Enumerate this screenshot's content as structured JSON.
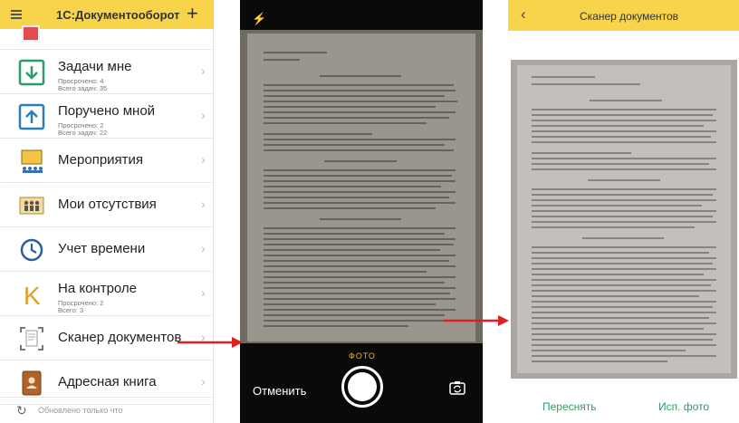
{
  "app": {
    "title": "1С:Документооборот",
    "footer_text": "Обновлено только что",
    "items": [
      {
        "label": "Задачи мне",
        "sub1": "Просрочено: 4",
        "sub2": "Всего задач: 35",
        "icon": "download-task-icon"
      },
      {
        "label": "Поручено мной",
        "sub1": "Просрочено: 2",
        "sub2": "Всего задач: 22",
        "icon": "upload-task-icon"
      },
      {
        "label": "Мероприятия",
        "icon": "presentation-icon"
      },
      {
        "label": "Мои отсутствия",
        "icon": "absence-people-icon"
      },
      {
        "label": "Учет времени",
        "icon": "clock-icon"
      },
      {
        "label": "На контроле",
        "sub1": "Просрочено: 2",
        "sub2": "Всего: 3",
        "icon": "control-k-icon"
      },
      {
        "label": "Сканер документов",
        "icon": "scanner-icon"
      },
      {
        "label": "Адресная книга",
        "icon": "address-book-icon"
      }
    ]
  },
  "camera": {
    "mode_label": "ФОТО",
    "cancel_label": "Отменить"
  },
  "scanner": {
    "title": "Сканер документов",
    "retake_label": "Переснять",
    "use_photo_label": "Исп. фото"
  },
  "colors": {
    "header_yellow": "#f7d44a",
    "accent_green": "#2f9e64",
    "arrow_red": "#e02020",
    "photo_label": "#e8b53a"
  }
}
